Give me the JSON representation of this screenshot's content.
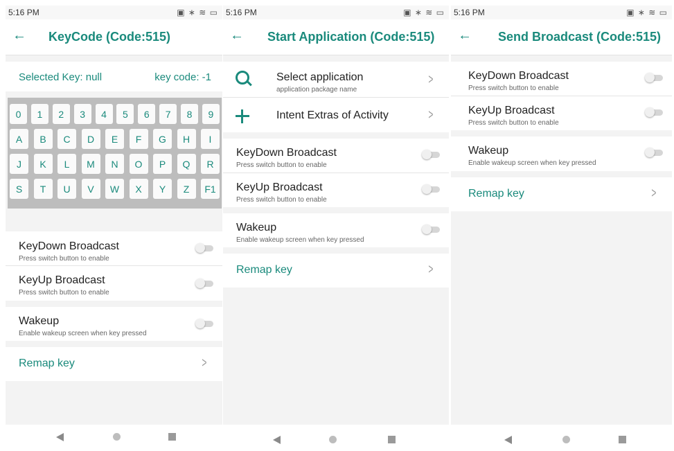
{
  "status": {
    "time": "5:16 PM",
    "icons": "▣ ∗ ≋ ▭"
  },
  "screen1": {
    "title": "KeyCode (Code:515)",
    "selected_key": "Selected Key: null",
    "key_code": "key code: -1",
    "keys": [
      [
        "0",
        "1",
        "2",
        "3",
        "4",
        "5",
        "6",
        "7",
        "8",
        "9"
      ],
      [
        "A",
        "B",
        "C",
        "D",
        "E",
        "F",
        "G",
        "H",
        "I"
      ],
      [
        "J",
        "K",
        "L",
        "M",
        "N",
        "O",
        "P",
        "Q",
        "R"
      ],
      [
        "S",
        "T",
        "U",
        "V",
        "W",
        "X",
        "Y",
        "Z",
        "F1"
      ]
    ],
    "keydown_title": "KeyDown Broadcast",
    "keydown_sub": "Press switch button to enable",
    "keyup_title": "KeyUp Broadcast",
    "keyup_sub": "Press switch button to enable",
    "wakeup_title": "Wakeup",
    "wakeup_sub": "Enable wakeup screen when key pressed",
    "remap": "Remap key"
  },
  "screen2": {
    "title": "Start Application (Code:515)",
    "select_app_title": "Select application",
    "select_app_sub": "application package name",
    "intent_title": "Intent Extras of Activity",
    "keydown_title": "KeyDown Broadcast",
    "keydown_sub": "Press switch button to enable",
    "keyup_title": "KeyUp Broadcast",
    "keyup_sub": "Press switch button to enable",
    "wakeup_title": "Wakeup",
    "wakeup_sub": "Enable wakeup screen when key pressed",
    "remap": "Remap key"
  },
  "screen3": {
    "title": "Send Broadcast (Code:515)",
    "keydown_title": "KeyDown Broadcast",
    "keydown_sub": "Press switch button to enable",
    "keyup_title": "KeyUp Broadcast",
    "keyup_sub": "Press switch button to enable",
    "wakeup_title": "Wakeup",
    "wakeup_sub": "Enable wakeup screen when key pressed",
    "remap": "Remap key"
  },
  "toggles": {
    "state": "off"
  },
  "colors": {
    "accent": "#1a8a7c",
    "background": "#f3f3f3",
    "keypad": "#bdbdbd"
  }
}
